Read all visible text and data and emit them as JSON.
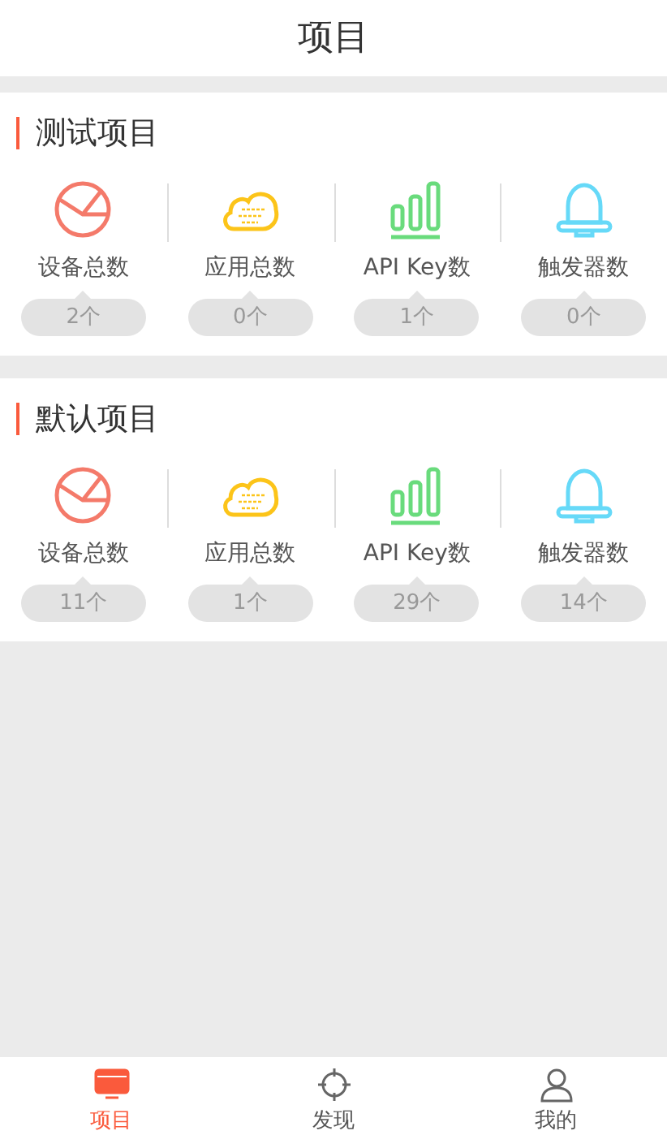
{
  "header": {
    "title": "项目"
  },
  "projects": [
    {
      "name": "测试项目",
      "stats": [
        {
          "kind": "device",
          "label": "设备总数",
          "count": "2个"
        },
        {
          "kind": "app",
          "label": "应用总数",
          "count": "0个"
        },
        {
          "kind": "apikey",
          "label": "API Key数",
          "count": "1个"
        },
        {
          "kind": "trigger",
          "label": "触发器数",
          "count": "0个"
        }
      ]
    },
    {
      "name": "默认项目",
      "stats": [
        {
          "kind": "device",
          "label": "设备总数",
          "count": "11个"
        },
        {
          "kind": "app",
          "label": "应用总数",
          "count": "1个"
        },
        {
          "kind": "apikey",
          "label": "API Key数",
          "count": "29个"
        },
        {
          "kind": "trigger",
          "label": "触发器数",
          "count": "14个"
        }
      ]
    }
  ],
  "tabbar": [
    {
      "kind": "project",
      "label": "项目",
      "selected": true
    },
    {
      "kind": "discover",
      "label": "发现",
      "selected": false
    },
    {
      "kind": "profile",
      "label": "我的",
      "selected": false
    }
  ]
}
